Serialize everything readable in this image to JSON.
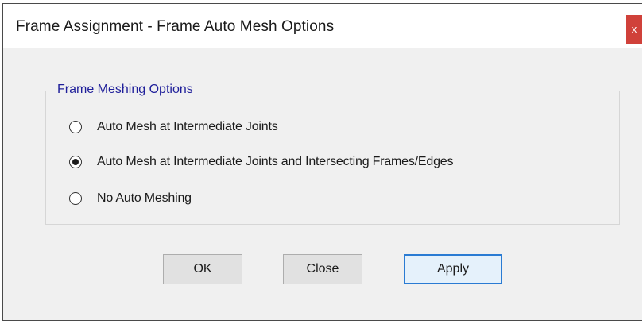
{
  "window": {
    "title": "Frame Assignment - Frame Auto Mesh Options",
    "close_glyph": "x"
  },
  "group": {
    "legend": "Frame Meshing Options",
    "options": [
      {
        "label": "Auto Mesh at Intermediate Joints",
        "checked": false
      },
      {
        "label": "Auto Mesh at Intermediate Joints and Intersecting Frames/Edges",
        "checked": true
      },
      {
        "label": "No Auto Meshing",
        "checked": false
      }
    ]
  },
  "buttons": {
    "ok": "OK",
    "close": "Close",
    "apply": "Apply"
  },
  "colors": {
    "legend": "#1f1f9a",
    "close_bg": "#d0413a",
    "default_button_border": "#2a7bd3"
  }
}
